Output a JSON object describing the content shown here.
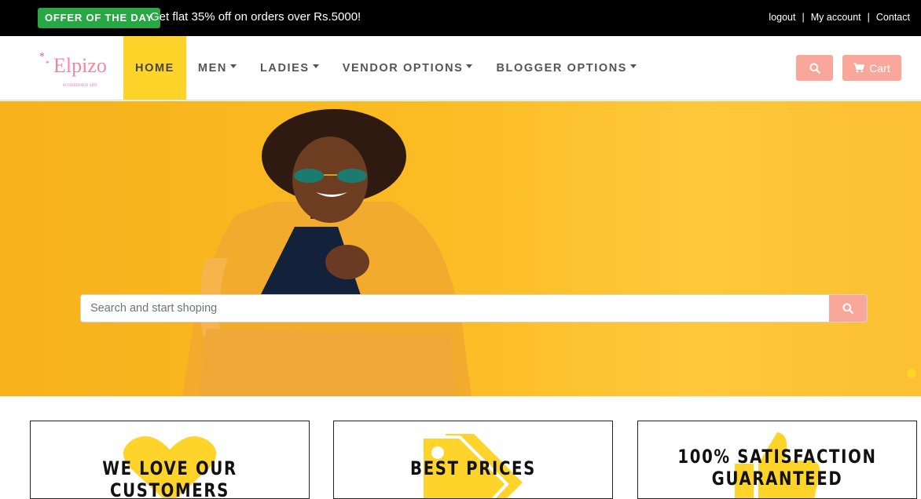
{
  "topbar": {
    "offer_badge": "OFFER OF THE DAY",
    "offer_text": "Get flat 35% off on orders over Rs.5000!",
    "links": [
      "logout",
      "My account",
      "Contact"
    ]
  },
  "brand": {
    "name": "Elpizo",
    "tagline": "ecommerce site"
  },
  "nav": {
    "items": [
      {
        "label": "HOME",
        "active": true
      },
      {
        "label": "MEN",
        "dropdown": true
      },
      {
        "label": "LADIES",
        "dropdown": true
      },
      {
        "label": "VENDOR OPTIONS",
        "dropdown": true
      },
      {
        "label": "BLOGGER OPTIONS",
        "dropdown": true
      }
    ],
    "search_icon": "search-icon",
    "cart_label": "Cart",
    "cart_icon": "cart-icon"
  },
  "hero": {
    "search_placeholder": "Search and start shoping",
    "search_value": "",
    "search_icon": "search-icon"
  },
  "features": [
    {
      "title": "WE LOVE OUR CUSTOMERS",
      "icon": "heart-icon"
    },
    {
      "title": "BEST PRICES",
      "icon": "tag-icon"
    },
    {
      "title_line1": "100% SATISFACTION",
      "title_line2": "GUARANTEED",
      "icon": "thumbs-up-icon"
    }
  ],
  "colors": {
    "accent_yellow": "#ffd42a",
    "button_salmon": "#f8a79a",
    "offer_green": "#28a745",
    "hero_bg": "#fbbb22"
  }
}
